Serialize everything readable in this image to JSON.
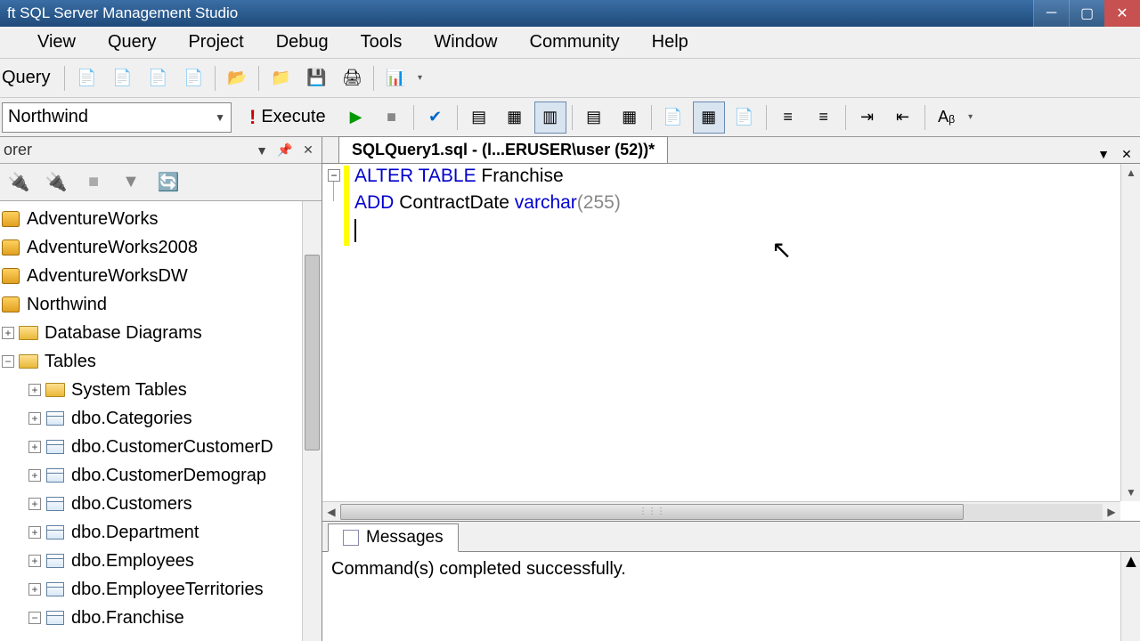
{
  "window": {
    "title": "ft SQL Server Management Studio"
  },
  "menu": [
    "View",
    "Query",
    "Project",
    "Debug",
    "Tools",
    "Window",
    "Community",
    "Help"
  ],
  "toolbar1": {
    "query_label": "Query"
  },
  "toolbar2": {
    "selected_db": "Northwind",
    "execute_label": "Execute"
  },
  "explorer": {
    "title": "orer",
    "databases": [
      "AdventureWorks",
      "AdventureWorks2008",
      "AdventureWorksDW",
      "Northwind"
    ],
    "folders": {
      "diagrams": "Database Diagrams",
      "tables": "Tables",
      "system_tables": "System Tables"
    },
    "tables": [
      "dbo.Categories",
      "dbo.CustomerCustomerD",
      "dbo.CustomerDemograp",
      "dbo.Customers",
      "dbo.Department",
      "dbo.Employees",
      "dbo.EmployeeTerritories",
      "dbo.Franchise"
    ]
  },
  "editor": {
    "tab_title": "SQLQuery1.sql - (l...ERUSER\\user (52))*",
    "code": {
      "line1_kw1": "ALTER",
      "line1_kw2": "TABLE",
      "line1_ident": "Franchise",
      "line2_kw": "ADD",
      "line2_ident": "ContractDate",
      "line2_type": "varchar",
      "line2_num": "255"
    }
  },
  "messages": {
    "tab_label": "Messages",
    "text": "Command(s) completed successfully."
  }
}
